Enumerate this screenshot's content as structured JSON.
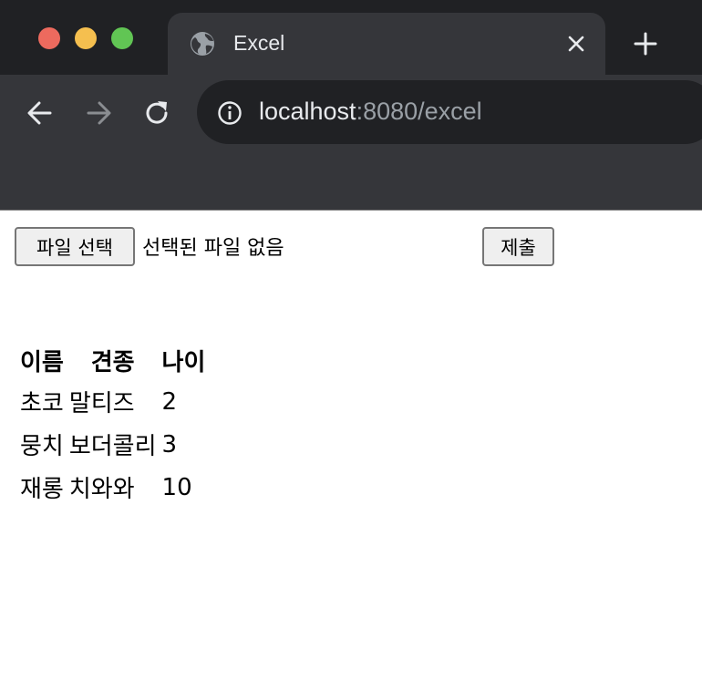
{
  "browser": {
    "tab_title": "Excel",
    "url_host": "localhost",
    "url_rest": ":8080/excel",
    "icons": {
      "tab_favicon": "globe-icon",
      "tab_close": "close-icon",
      "new_tab": "plus-icon",
      "back": "arrow-left-icon",
      "forward": "arrow-right-icon",
      "reload": "reload-icon",
      "site_info": "info-icon"
    },
    "colors": {
      "close": "#ed6a5e",
      "minimize": "#f5bf4f",
      "maximize": "#61c554"
    }
  },
  "form": {
    "file_button_label": "파일 선택",
    "file_status": "선택된 파일 없음",
    "submit_label": "제출"
  },
  "table": {
    "headers": [
      "이름",
      "견종",
      "나이"
    ],
    "rows": [
      [
        "초코",
        "말티즈",
        "2"
      ],
      [
        "뭉치",
        "보더콜리",
        "3"
      ],
      [
        "재롱",
        "치와와",
        "10"
      ]
    ]
  }
}
